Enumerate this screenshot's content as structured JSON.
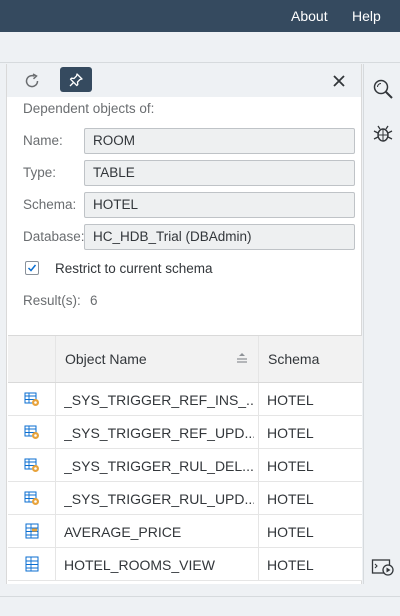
{
  "header": {
    "about_label": "About",
    "help_label": "Help"
  },
  "panel": {
    "title": "Dependent objects of:",
    "name_label": "Name:",
    "name_value": "ROOM",
    "type_label": "Type:",
    "type_value": "TABLE",
    "schema_label": "Schema:",
    "schema_value": "HOTEL",
    "database_label": "Database:",
    "database_value": "HC_HDB_Trial (DBAdmin)",
    "restrict_label": "Restrict to current schema",
    "restrict_checked": true,
    "results_label": "Result(s):",
    "results_count": "6"
  },
  "table": {
    "columns": [
      "Object Name",
      "Schema"
    ],
    "rows": [
      {
        "icon": "trigger-icon",
        "name": "_SYS_TRIGGER_REF_INS_...",
        "schema": "HOTEL"
      },
      {
        "icon": "trigger-icon",
        "name": "_SYS_TRIGGER_REF_UPD...",
        "schema": "HOTEL"
      },
      {
        "icon": "trigger-icon",
        "name": "_SYS_TRIGGER_RUL_DEL...",
        "schema": "HOTEL"
      },
      {
        "icon": "trigger-icon",
        "name": "_SYS_TRIGGER_RUL_UPD...",
        "schema": "HOTEL"
      },
      {
        "icon": "procedure-icon",
        "name": "AVERAGE_PRICE",
        "schema": "HOTEL"
      },
      {
        "icon": "view-icon",
        "name": "HOTEL_ROOMS_VIEW",
        "schema": "HOTEL"
      }
    ]
  },
  "colors": {
    "shell": "#354a5f",
    "accent": "#0a6ed1",
    "icon_gold": "#e8a33b"
  }
}
